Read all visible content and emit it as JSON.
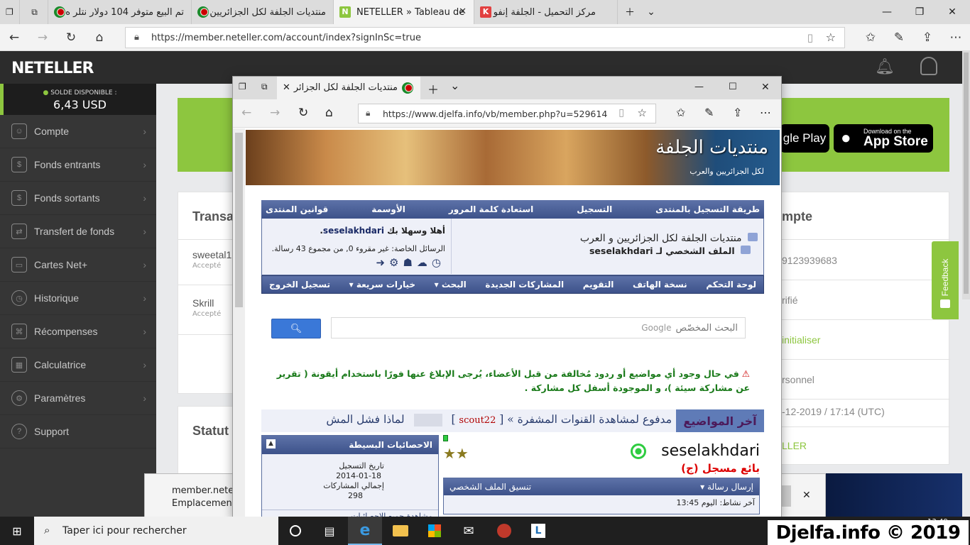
{
  "outer_browser": {
    "tabs": [
      {
        "label": "تم البيع متوفر 104 دولار نتلر ه",
        "active": false
      },
      {
        "label": "منتديات الجلفة لكل الجزائريين",
        "active": false
      },
      {
        "label": "NETELLER » Tableau de",
        "active": true
      },
      {
        "label": "مركز التحميل - الجلفة إنفو",
        "active": false
      }
    ],
    "url": "https://member.neteller.com/account/index?signInSc=true"
  },
  "neteller": {
    "logo": "NETELLER",
    "balance_label": "SOLDE DISPONIBLE :",
    "balance_value": "6,43 USD",
    "menu": [
      "Compte",
      "Fonds entrants",
      "Fonds sortants",
      "Transfert de fonds",
      "Cartes Net+",
      "Historique",
      "Récompenses",
      "Calculatrice",
      "Paramètres",
      "Support"
    ],
    "store_badges": {
      "google_play": "gle Play",
      "app_store_top": "Download on the",
      "app_store": "App Store"
    },
    "transactions_title": "Transa",
    "transactions": [
      {
        "name": "sweetal1",
        "status": "Accepté"
      },
      {
        "name": "Skrill",
        "status": "Accepté"
      }
    ],
    "statut_title": "Statut",
    "account_title": "mpte",
    "account_rows": [
      "9123939683",
      "rifié",
      "initialiser",
      "rsonnel",
      "-12-2019 / 17:14 (UTC)",
      "LLER"
    ],
    "feedback": "Feedback"
  },
  "inner_browser": {
    "tab_label": "منتديات الجلفة لكل الجزائر",
    "url": "https://www.djelfa.info/vb/member.php?u=529614"
  },
  "forum": {
    "banner_logo": "منتديات الجلفة",
    "banner_sub": "لكل الجزائريين والعرب",
    "top_nav": [
      "طريقة التسجيل بالمنتدى",
      "التسجيل",
      "استعادة كلمة المرور",
      "الأوسمة",
      "قوانين المنتدى"
    ],
    "site_title": "منتديات الجلفة لكل الجزائريين و العرب",
    "profile_prefix": "الملف الشخصي لـ",
    "username": "seselakhdari",
    "welcome": "أهلا وسهلا بك",
    "pm_text": "الرسائل الخاصة: غير مقروء 0, من مجموع 43 رسالة.",
    "sub_nav": [
      "لوحة التحكم",
      "نسخة الهاتف",
      "التقويم",
      "المشاركات الجديدة",
      "البحث",
      "خيارات سريعة",
      "تسجيل الخروج"
    ],
    "search_placeholder": "البحث المخصّص",
    "search_google": "Google",
    "notice": "في حال وجود أي مواضيع أو ردود مُخالفة من قبل الأعضاء، يُرجى الإبلاغ عنها فورًا باستخدام أيقونة ( تقرير عن مشاركة سيئة )، و الموجودة أسفل كل مشاركة .",
    "latest_title": "آخر المواضيع",
    "latest_topic1": "مدفوع لمشاهدة القنوات المشفرة »",
    "latest_user": "scout22",
    "latest_topic2": "لماذا فشل المش",
    "stats_title": "الاحصائيات البسيطة",
    "stats": [
      {
        "label": "تاريخ التسجيل",
        "value": "2014-01-18"
      },
      {
        "label": "إجمالي المشاركات",
        "value": "298"
      }
    ],
    "stats_link": "مشاهدة جميع الاحصائيات",
    "profile_username": "seselakhdari",
    "rank": "بائع مسجل (ج)",
    "send_message": "إرسال رسالة",
    "format_profile": "تنسيق الملف الشخصي",
    "last_activity": "آخر نشاط: اليوم 13:45"
  },
  "download_bar": {
    "line1": "member.netel",
    "line2": "Emplacement"
  },
  "taskbar": {
    "search_placeholder": "Taper ici pour rechercher",
    "time": "13:49"
  },
  "watermark": "Djelfa.info © 2019",
  "colors": {
    "neteller_green": "#8dc63f",
    "forum_blue": "#3d528a"
  }
}
